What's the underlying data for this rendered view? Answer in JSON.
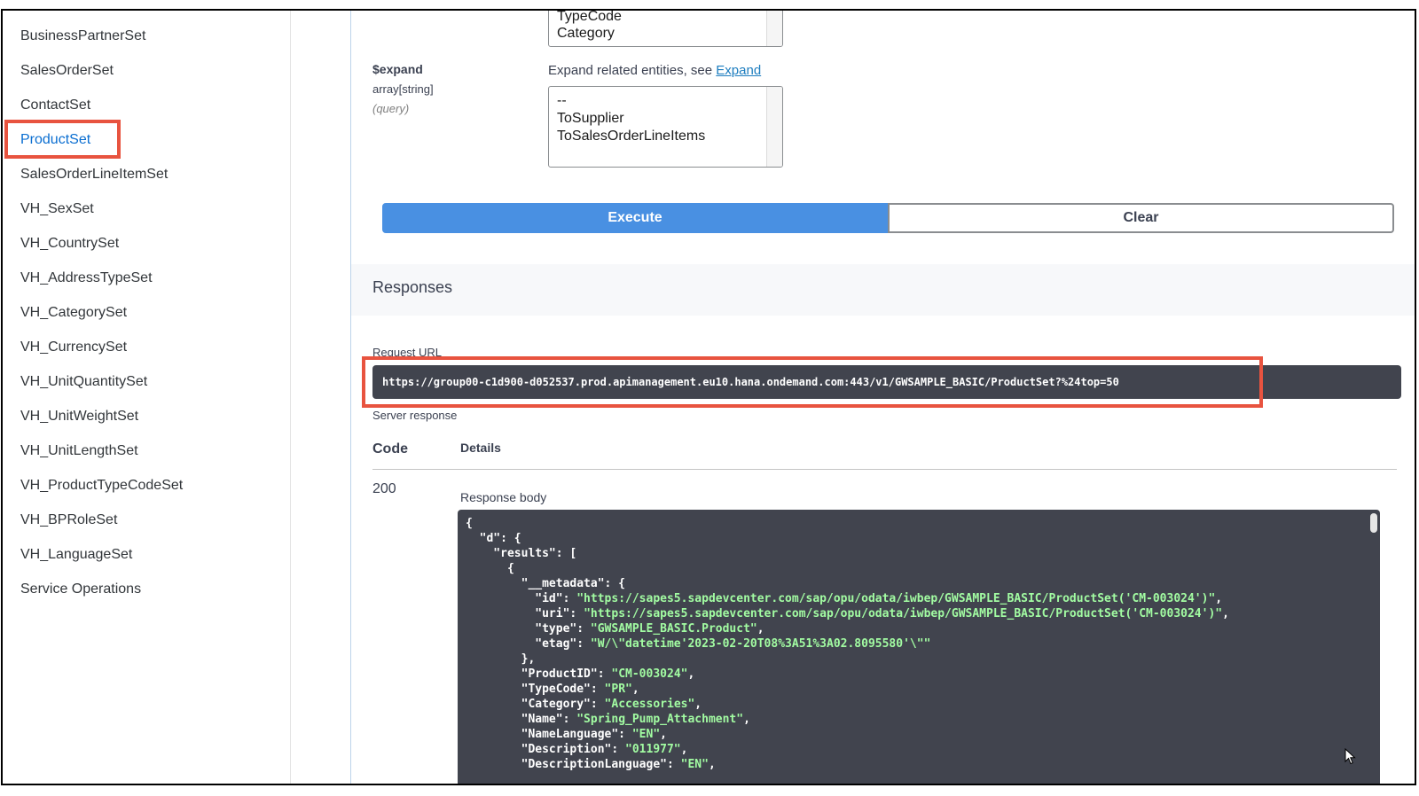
{
  "sidebar": {
    "items": [
      {
        "label": "BusinessPartnerSet"
      },
      {
        "label": "SalesOrderSet"
      },
      {
        "label": "ContactSet"
      },
      {
        "label": "ProductSet"
      },
      {
        "label": "SalesOrderLineItemSet"
      },
      {
        "label": "VH_SexSet"
      },
      {
        "label": "VH_CountrySet"
      },
      {
        "label": "VH_AddressTypeSet"
      },
      {
        "label": "VH_CategorySet"
      },
      {
        "label": "VH_CurrencySet"
      },
      {
        "label": "VH_UnitQuantitySet"
      },
      {
        "label": "VH_UnitWeightSet"
      },
      {
        "label": "VH_UnitLengthSet"
      },
      {
        "label": "VH_ProductTypeCodeSet"
      },
      {
        "label": "VH_BPRoleSet"
      },
      {
        "label": "VH_LanguageSet"
      },
      {
        "label": "Service Operations"
      }
    ],
    "active": "ProductSet"
  },
  "select_listbox": {
    "options": [
      "TypeCode",
      "Category"
    ]
  },
  "expand_param": {
    "name": "$expand",
    "type": "array[string]",
    "in": "(query)",
    "description": "Expand related entities, see",
    "link_text": "Expand",
    "options": [
      "--",
      "ToSupplier",
      "ToSalesOrderLineItems"
    ]
  },
  "actions": {
    "execute_label": "Execute",
    "clear_label": "Clear"
  },
  "responses": {
    "title": "Responses",
    "request_url_label": "Request URL",
    "request_url": "https://group00-c1d900-d052537.prod.apimanagement.eu10.hana.ondemand.com:443/v1/GWSAMPLE_BASIC/ProductSet?%24top=50",
    "server_response_label": "Server response",
    "code_header": "Code",
    "details_header": "Details",
    "status_code": "200",
    "body_label": "Response body",
    "body": {
      "metadata_id": "\"https://sapes5.sapdevcenter.com/sap/opu/odata/iwbep/GWSAMPLE_BASIC/ProductSet('CM-003024')\"",
      "metadata_uri": "\"https://sapes5.sapdevcenter.com/sap/opu/odata/iwbep/GWSAMPLE_BASIC/ProductSet('CM-003024')\"",
      "metadata_type": "\"GWSAMPLE_BASIC.Product\"",
      "metadata_etag": "\"W/\\\"datetime'2023-02-20T08%3A51%3A02.8095580'\\\"\"",
      "product_id": "\"CM-003024\"",
      "type_code": "\"PR\"",
      "category": "\"Accessories\"",
      "name": "\"Spring_Pump_Attachment\"",
      "name_language": "\"EN\"",
      "description": "\"011977\"",
      "description_language": "\"EN\""
    }
  },
  "colors": {
    "accent": "#4990e2",
    "highlight": "#e8533f",
    "code_bg": "#41444e",
    "code_string": "#a2fca2"
  }
}
